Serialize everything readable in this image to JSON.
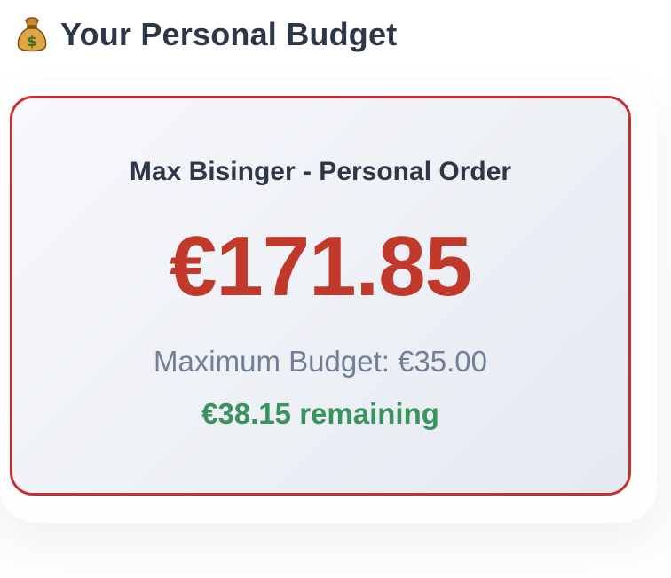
{
  "header": {
    "icon": "money-bag-icon",
    "title": "Your Personal Budget"
  },
  "budget_card": {
    "owner_label": "Max Bisinger - Personal Order",
    "amount": "€171.85",
    "max_budget_text": "Maximum Budget: €35.00",
    "remaining_text": "€38.15 remaining"
  },
  "colors": {
    "title": "#2d3748",
    "card_border": "#c53030",
    "amount": "#c0392b",
    "max_budget": "#718096",
    "remaining": "#38935f"
  }
}
